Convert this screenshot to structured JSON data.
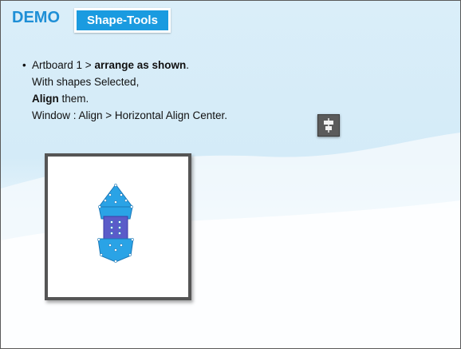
{
  "header": {
    "demo_label": "DEMO",
    "badge_label": "Shape-Tools"
  },
  "instructions": {
    "bullet": "•",
    "line1_prefix": "Artboard 1 > ",
    "line1_bold": "arrange as shown",
    "line1_suffix": ".",
    "line2": "With shapes Selected,",
    "line3_bold": "Align",
    "line3_suffix": " them.",
    "line4": "Window : Align  > Horizontal Align Center."
  },
  "icons": {
    "align_button": "horizontal-align-center-icon"
  },
  "colors": {
    "accent": "#1e8fd6",
    "badge_bg": "#1a9be0",
    "shape_blue": "#2aa3e6",
    "shape_purple": "#5b5bc9"
  }
}
